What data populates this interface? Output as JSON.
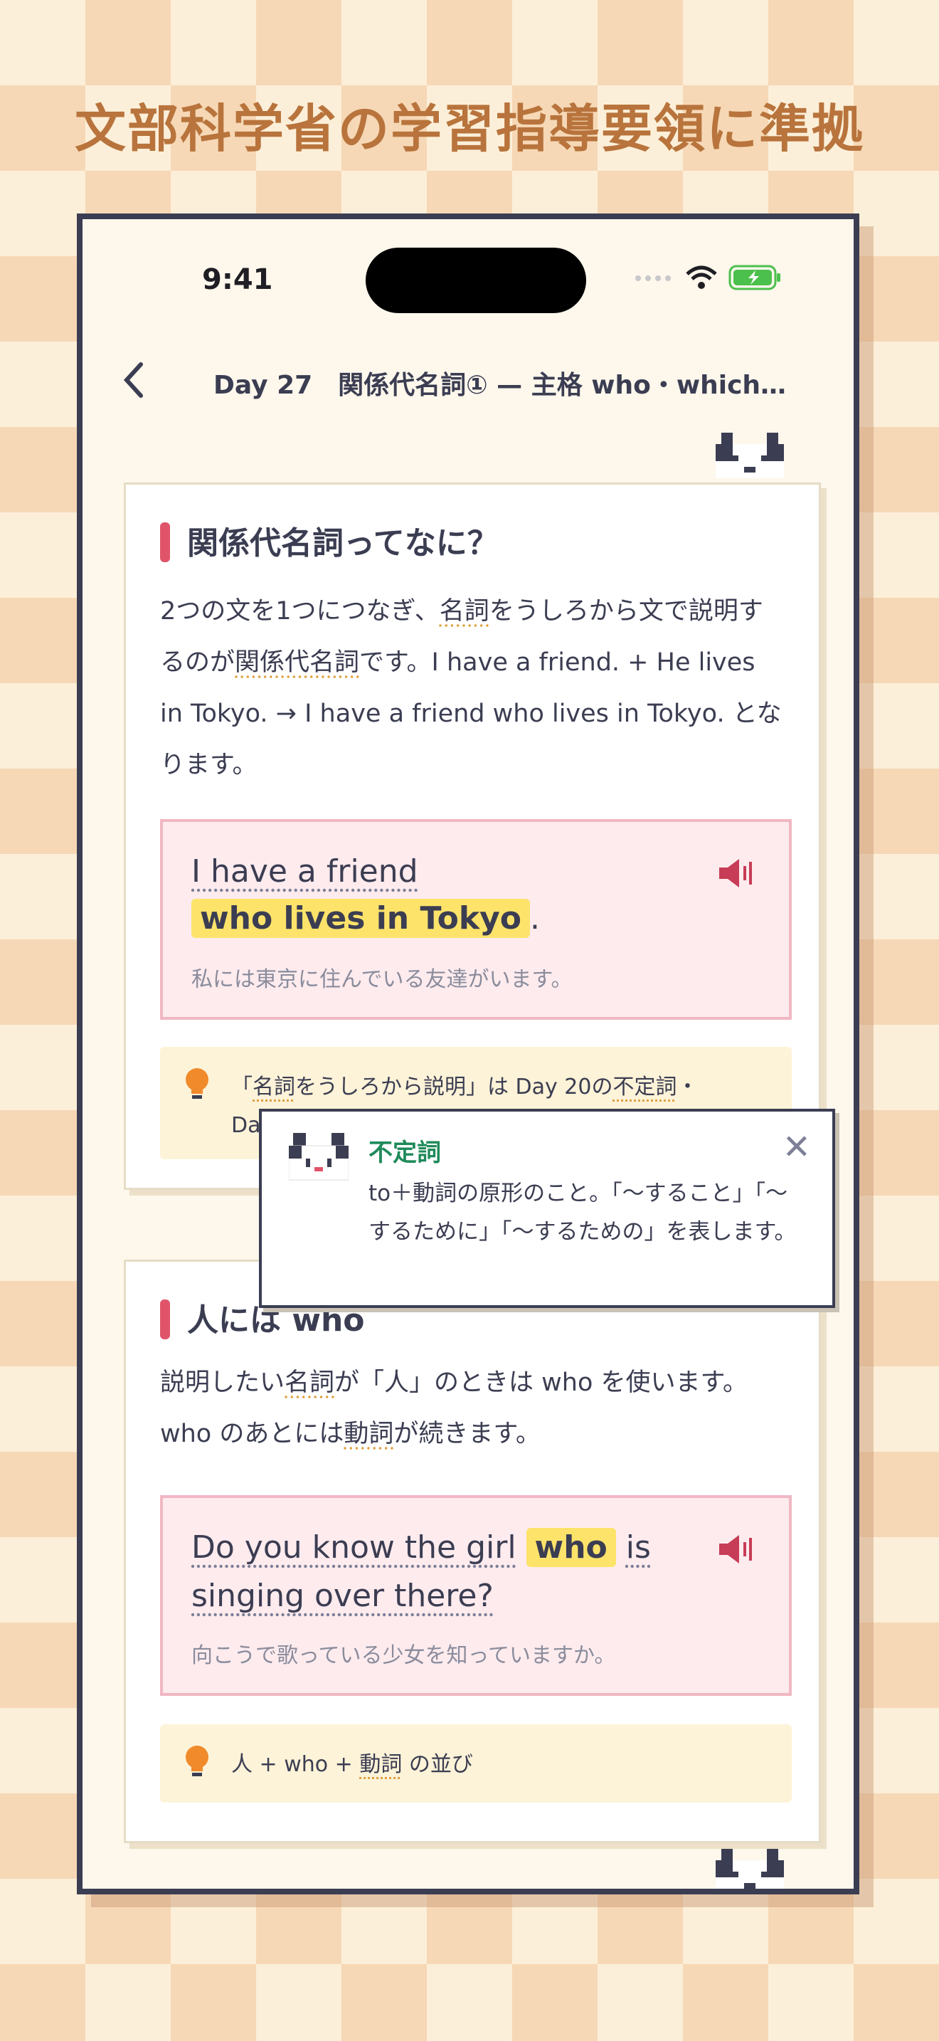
{
  "headline": "文部科学省の学習指導要領に準拠",
  "status": {
    "time": "9:41"
  },
  "nav": {
    "title": "Day 27　関係代名詞① — 主格 who・which…"
  },
  "section1": {
    "title": "関係代名詞ってなに？",
    "body_prefix": "2つの文を1つにつなぎ、",
    "body_term1": "名詞",
    "body_mid": "をうしろから文で説明するのが",
    "body_term2": "関係代名詞",
    "body_suffix": "です。I have a friend. + He lives in Tokyo. → I have a friend who lives in Tokyo. となります。",
    "example": {
      "line1": "I have a friend",
      "highlight": "who lives in Tokyo",
      "period": ".",
      "translation": "私には東京に住んでいる友達がいます。"
    },
    "tip_open": "「",
    "tip_term": "名詞",
    "tip_rest": "をうしろから説明」は Day 20の",
    "tip_term2": "不定詞",
    "tip_end": "・",
    "tip_line2": "Day"
  },
  "tooltip": {
    "title": "不定詞",
    "body": "to＋動詞の原形のこと。「〜すること」「〜するために」「〜するための」を表します。"
  },
  "section2": {
    "title": "人には who",
    "body_a": "説明したい",
    "body_term1": "名詞",
    "body_b": "が「人」のときは who を使います。who のあとには",
    "body_term2": "動詞",
    "body_c": "が続きます。",
    "example": {
      "pre": "Do you know the girl",
      "highlight": "who",
      "post": "is",
      "line2": "singing over there?",
      "translation": "向こうで歌っている少女を知っていますか。"
    },
    "tip_a": "人 + who + ",
    "tip_term": "動詞",
    "tip_b": " の並び"
  },
  "colors": {
    "accent": "#e0546a",
    "highlight": "#fde36a",
    "term": "#1f8a5a",
    "headline": "#b8743c"
  }
}
